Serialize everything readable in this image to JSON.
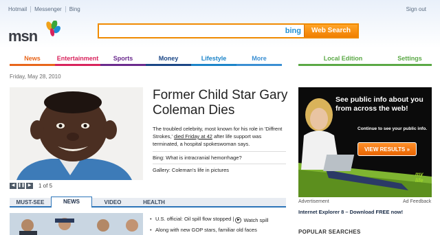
{
  "header": {
    "links": [
      "Hotmail",
      "Messenger",
      "Bing"
    ],
    "sign_out": "Sign out",
    "logo_text": "msn"
  },
  "search": {
    "value": "",
    "bing_label": "bing",
    "button_label": "Web Search"
  },
  "nav": {
    "left": [
      {
        "label": "News",
        "color": "#e8651a"
      },
      {
        "label": "Entertainment",
        "color": "#d8235c"
      },
      {
        "label": "Sports",
        "color": "#6a2a8d"
      },
      {
        "label": "Money",
        "color": "#1a4686"
      },
      {
        "label": "Lifestyle",
        "color": "#1b84c9"
      },
      {
        "label": "More",
        "color": "#3a8fd3"
      }
    ],
    "right": [
      {
        "label": "Local Edition",
        "color": "#5aa845"
      },
      {
        "label": "Settings",
        "color": "#5aa845"
      }
    ]
  },
  "date": "Friday, May 28, 2010",
  "hero": {
    "headline": "Former Child Star Gary Coleman Dies",
    "summary_pre": "The troubled celebrity, most known for his role in 'Diffrent Strokes,'",
    "summary_link": "died Friday at 42",
    "summary_post": "after life support was terminated, a hospital spokeswoman says.",
    "related": [
      "Bing: What is intracranial hemorrhage?",
      "Gallery: Coleman's life in pictures"
    ],
    "slide_count": "1 of 5",
    "controls": [
      "◀",
      "❚❚",
      "▶"
    ]
  },
  "lower_tabs": [
    {
      "label": "MUST-SEE",
      "active": false
    },
    {
      "label": "NEWS",
      "active": true
    },
    {
      "label": "VIDEO",
      "active": false
    },
    {
      "label": "HEALTH",
      "active": false
    }
  ],
  "news_items": [
    {
      "text": "U.S. official: Oil spill flow stopped |",
      "watch": "Watch spill"
    },
    {
      "text": "Along with new GOP stars, familiar old faces",
      "watch": ""
    }
  ],
  "ad": {
    "headline": "See public info about you from across the web!",
    "sub": "Continue to see your public info.",
    "button": "VIEW RESULTS »",
    "brand": "my life",
    "label": "Advertisement",
    "feedback": "Ad Feedback"
  },
  "promo": "Internet Explorer 8 – Download FREE now!",
  "popular_heading": "POPULAR SEARCHES"
}
